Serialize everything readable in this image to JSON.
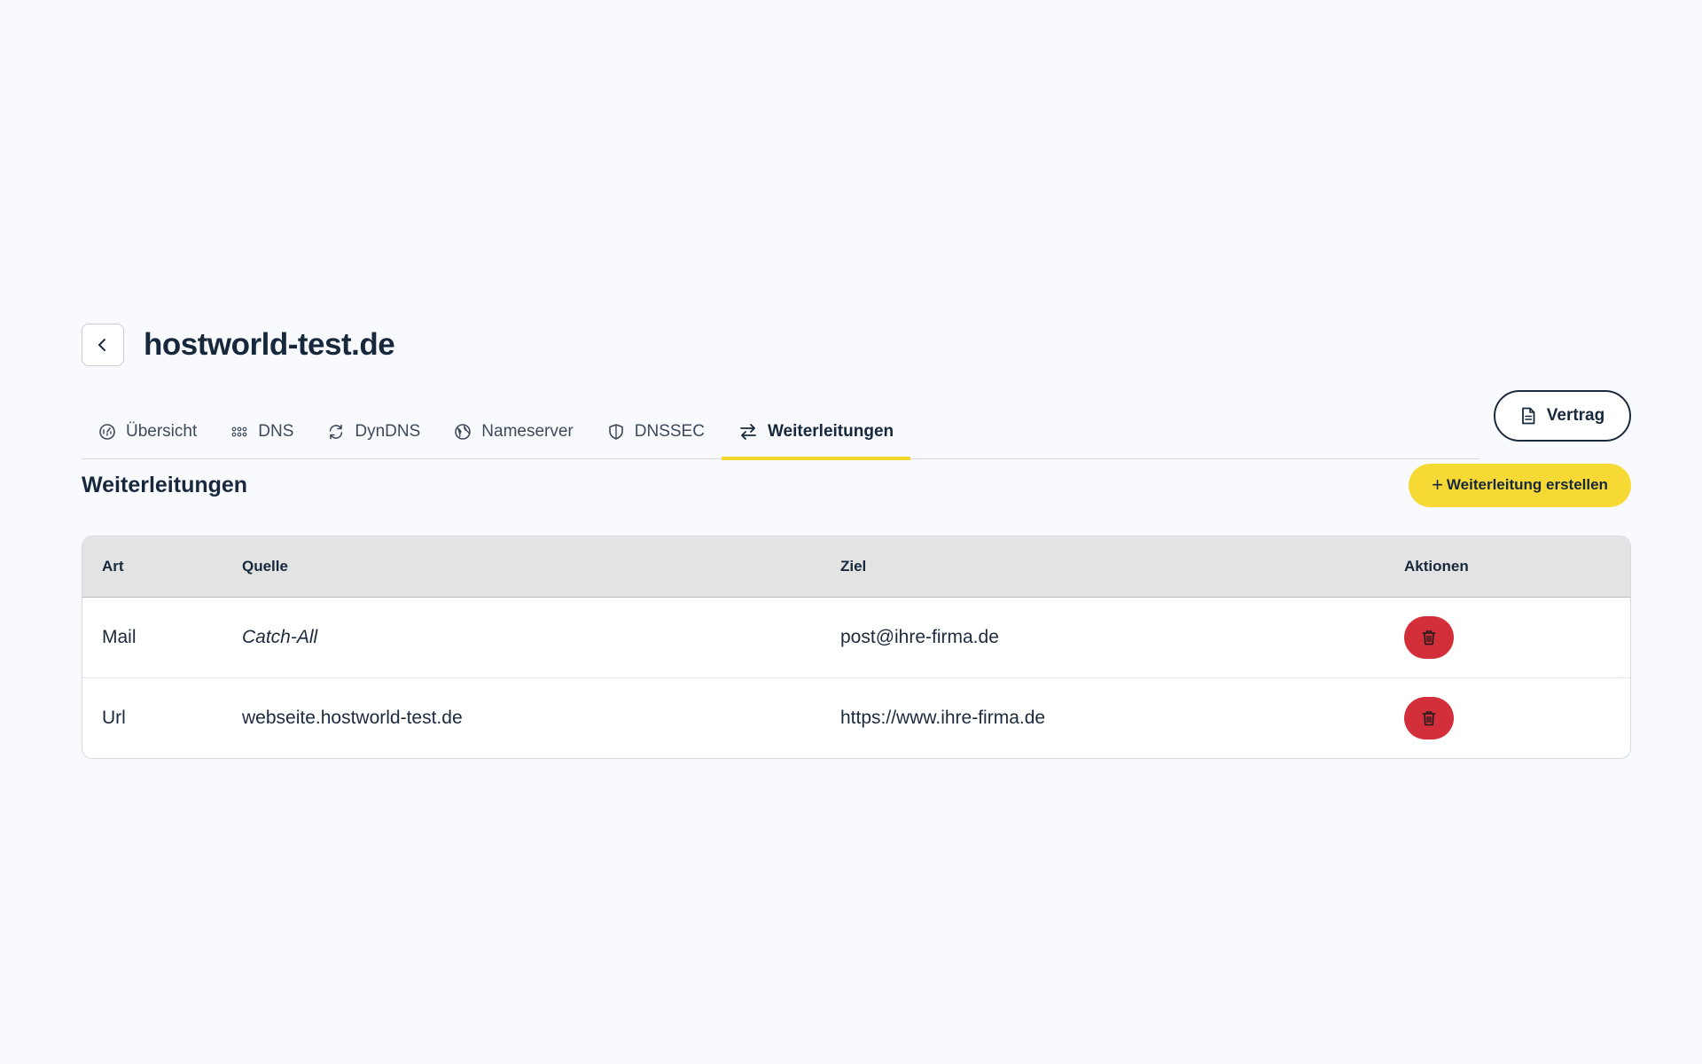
{
  "header": {
    "back_icon": "chevron-left-icon",
    "title": "hostworld-test.de"
  },
  "tabs": [
    {
      "label": "Übersicht",
      "icon": "dashboard-icon",
      "active": false
    },
    {
      "label": "DNS",
      "icon": "grid-dots-icon",
      "active": false
    },
    {
      "label": "DynDNS",
      "icon": "refresh-icon",
      "active": false
    },
    {
      "label": "Nameserver",
      "icon": "globe-icon",
      "active": false
    },
    {
      "label": "DNSSEC",
      "icon": "shield-icon",
      "active": false
    },
    {
      "label": "Weiterleitungen",
      "icon": "arrows-swap-icon",
      "active": true
    }
  ],
  "contract_button": {
    "label": "Vertrag",
    "icon": "document-icon"
  },
  "section": {
    "title": "Weiterleitungen",
    "create_button_plus": "+",
    "create_button_label": "Weiterleitung erstellen"
  },
  "table": {
    "headers": [
      "Art",
      "Quelle",
      "Ziel",
      "Aktionen"
    ],
    "rows": [
      {
        "art": "Mail",
        "quelle": "Catch-All",
        "ziel": "post@ihre-firma.de"
      },
      {
        "art": "Url",
        "quelle": "webseite.hostworld-test.de",
        "ziel": "https://www.ihre-firma.de"
      }
    ]
  },
  "colors": {
    "accent_yellow": "#f7d935",
    "danger_red": "#d32f3a",
    "text_dark": "#17283c",
    "background": "#f8fafd"
  }
}
